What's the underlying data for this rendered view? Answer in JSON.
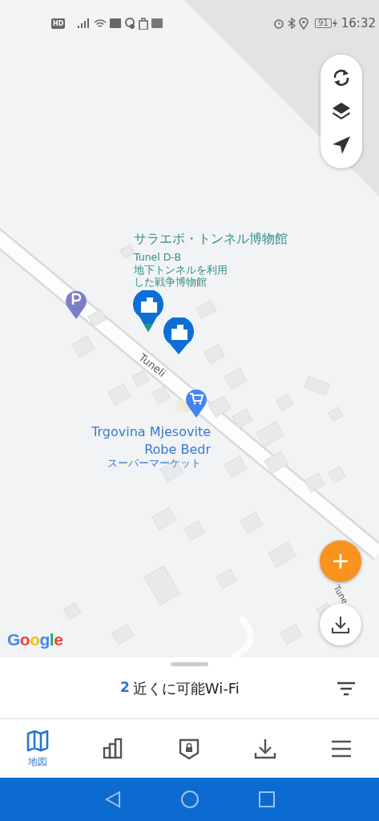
{
  "status_bar": {
    "hd_label": "HD",
    "battery": "91",
    "time": "16:32"
  },
  "map": {
    "labels": [
      {
        "kind": "poi-title",
        "text": "サラエボ・トンネル博物館"
      },
      {
        "kind": "poi-sub",
        "text": "Tunel D-B"
      },
      {
        "kind": "poi-sub",
        "text": "地下トンネルを利用"
      },
      {
        "kind": "poi-sub",
        "text": "した戦争博物館"
      },
      {
        "kind": "shop-title",
        "text": "Trgovina Mjesovite"
      },
      {
        "kind": "shop-title",
        "text": "Robe Bedr"
      },
      {
        "kind": "shop-sub",
        "text": "スーパーマーケット"
      },
      {
        "kind": "street",
        "text": "Tuneli"
      },
      {
        "kind": "street-edge",
        "text": "Tune"
      }
    ],
    "logo": "Google"
  },
  "sheet": {
    "count": "2",
    "title": "近くに可能Wi-Fi"
  },
  "tabs": [
    {
      "label": "地図",
      "selected": true
    },
    {
      "selected": false
    },
    {
      "selected": false
    },
    {
      "selected": false
    },
    {
      "selected": false
    }
  ]
}
